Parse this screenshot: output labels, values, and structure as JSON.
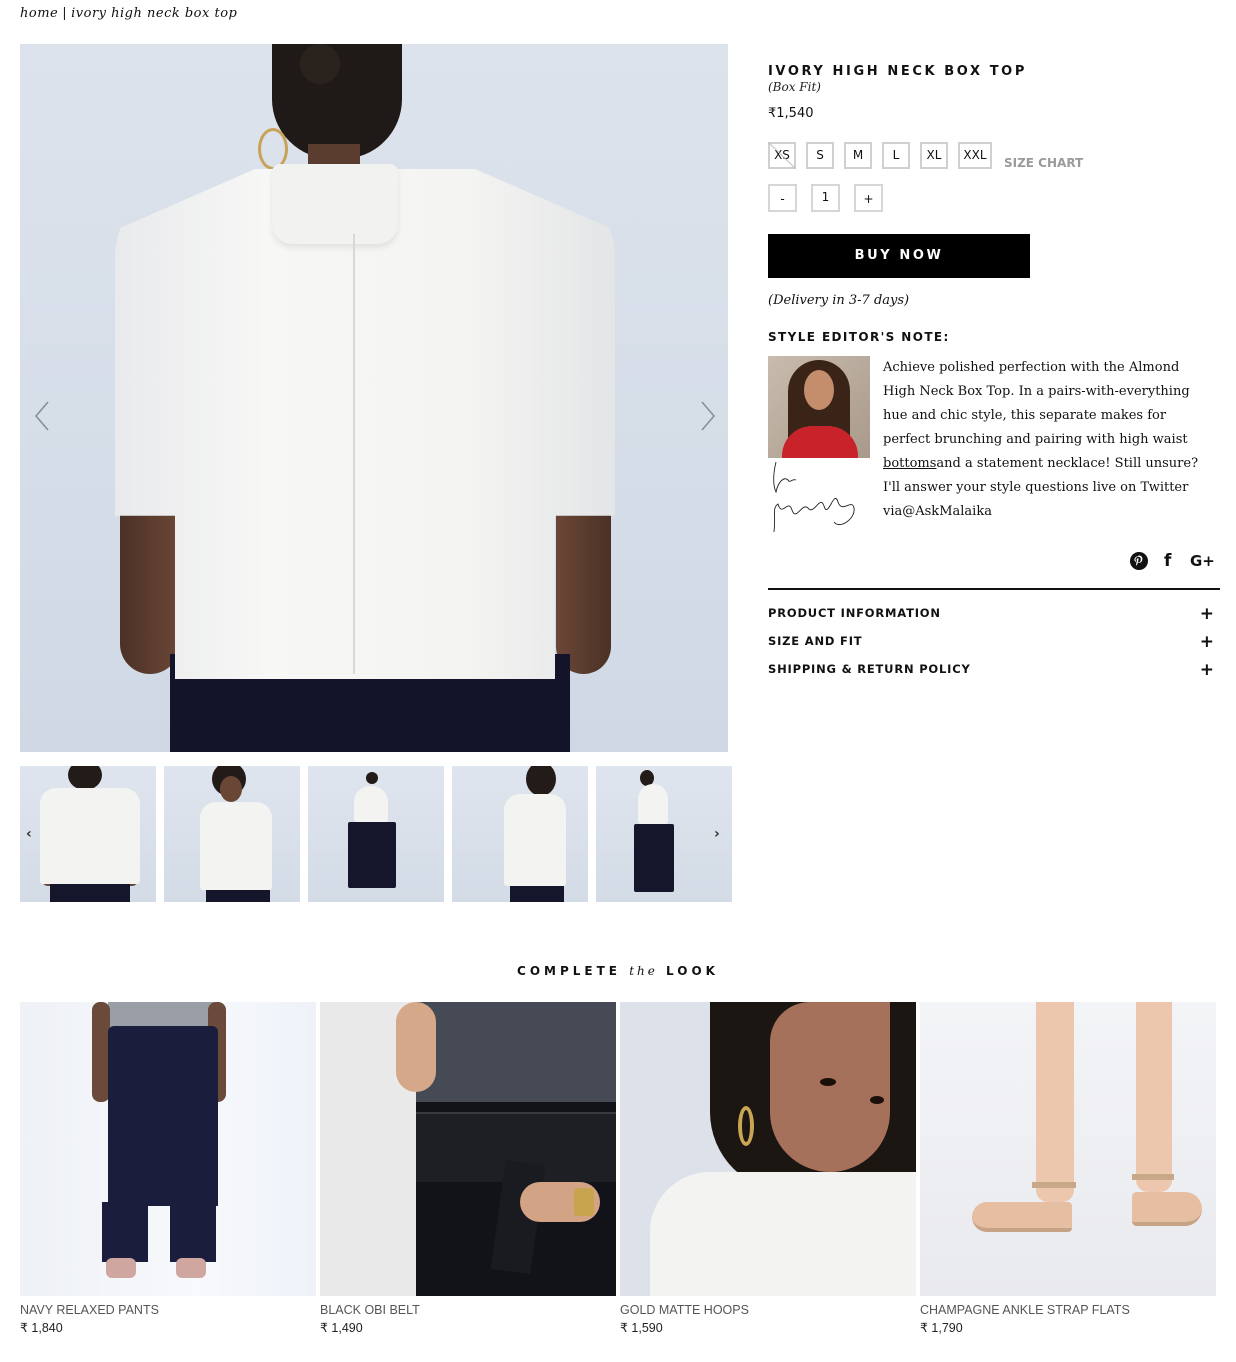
{
  "breadcrumb": {
    "home": "home",
    "separator": "|",
    "current": "ivory high neck box top"
  },
  "gallery": {
    "prev_icon": "chevron-left-icon",
    "next_icon": "chevron-right-icon",
    "thumbnail_count": 5,
    "thumb_prev": "‹",
    "thumb_next": "›"
  },
  "product": {
    "title": "IVORY HIGH NECK BOX TOP",
    "fit": "(Box Fit)",
    "price": "₹1,540",
    "sizes": [
      {
        "label": "XS",
        "available": false
      },
      {
        "label": "S",
        "available": true
      },
      {
        "label": "M",
        "available": true
      },
      {
        "label": "L",
        "available": true
      },
      {
        "label": "XL",
        "available": true
      },
      {
        "label": "XXL",
        "available": true
      }
    ],
    "size_chart_label": "SIZE CHART",
    "quantity": {
      "minus": "-",
      "value": "1",
      "plus": "+"
    },
    "buy_label": "BUY NOW",
    "delivery": "(Delivery in 3-7 days)"
  },
  "editor_note": {
    "heading": "STYLE EDITOR'S NOTE:",
    "text_before_link": "Achieve polished perfection with the Almond High Neck Box Top. In a pairs-with-everything hue and chic style, this separate makes for perfect brunching and pairing with high waist ",
    "link_text": "bottoms",
    "text_after_link": "and a statement necklace! Still unsure? I'll answer your style questions live on Twitter via@AskMalaika"
  },
  "social": [
    {
      "name": "pinterest",
      "glyph": "P"
    },
    {
      "name": "facebook",
      "glyph": "f"
    },
    {
      "name": "google-plus",
      "glyph": "G+"
    }
  ],
  "accordion": [
    {
      "label": "PRODUCT INFORMATION",
      "icon": "+"
    },
    {
      "label": "SIZE AND FIT",
      "icon": "+"
    },
    {
      "label": "SHIPPING & RETURN POLICY",
      "icon": "+"
    }
  ],
  "complete_the_look": {
    "title_left": "COMPLETE",
    "title_mid": "the",
    "title_right": "LOOK",
    "products": [
      {
        "name": "NAVY RELAXED PANTS",
        "price": "₹ 1,840"
      },
      {
        "name": "BLACK OBI BELT",
        "price": "₹ 1,490"
      },
      {
        "name": "GOLD MATTE HOOPS",
        "price": "₹ 1,590"
      },
      {
        "name": "CHAMPAGNE ANKLE STRAP FLATS",
        "price": "₹ 1,790"
      }
    ]
  },
  "colors": {
    "accent": "#000000",
    "size_chart": "#9a9a9a",
    "border": "#d0d0d0",
    "image_bg": "#d8dfe9"
  }
}
